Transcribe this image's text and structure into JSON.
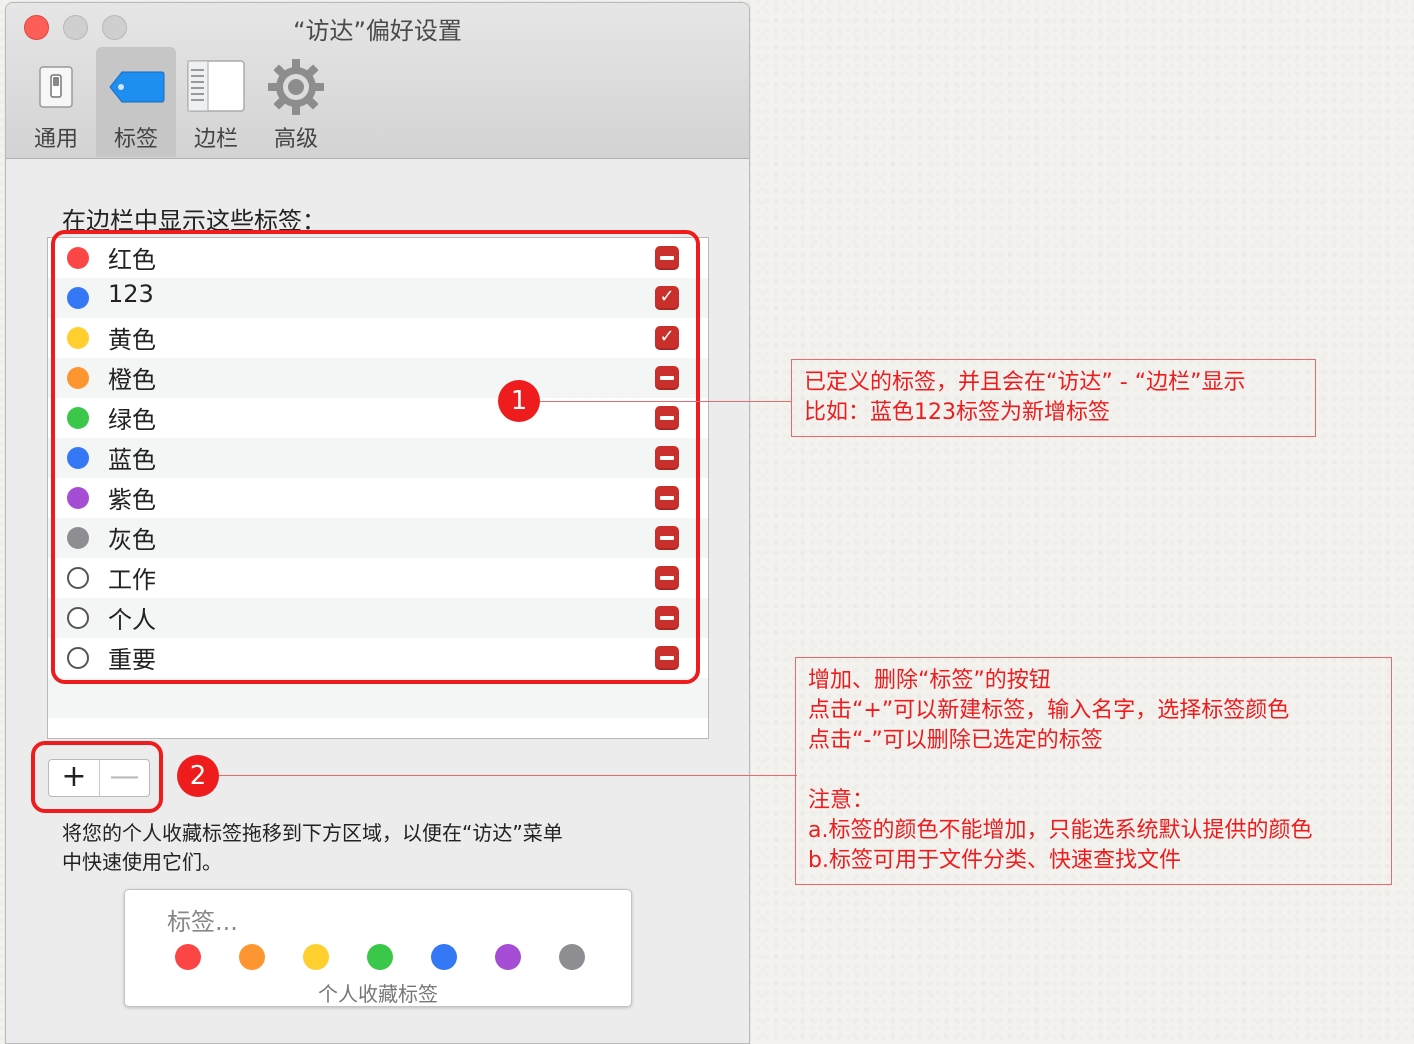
{
  "window": {
    "title": "“访达”偏好设置"
  },
  "toolbar": {
    "tabs": [
      {
        "label": "通用",
        "icon": "general-switch-icon"
      },
      {
        "label": "标签",
        "icon": "tag-icon"
      },
      {
        "label": "边栏",
        "icon": "sidebar-icon"
      },
      {
        "label": "高级",
        "icon": "gear-icon"
      }
    ],
    "selected": "标签"
  },
  "tags_section": {
    "heading": "在边栏中显示这些标签：",
    "rows": [
      {
        "name": "红色",
        "color": "#fc4646",
        "state": "minus"
      },
      {
        "name": "123",
        "color": "#3478f6",
        "state": "checked"
      },
      {
        "name": "黄色",
        "color": "#fecf2f",
        "state": "checked"
      },
      {
        "name": "橙色",
        "color": "#fd9630",
        "state": "minus"
      },
      {
        "name": "绿色",
        "color": "#3bc74a",
        "state": "minus"
      },
      {
        "name": "蓝色",
        "color": "#3478f6",
        "state": "minus"
      },
      {
        "name": "紫色",
        "color": "#a64dd6",
        "state": "minus"
      },
      {
        "name": "灰色",
        "color": "#8e8e92",
        "state": "minus"
      },
      {
        "name": "工作",
        "color": "",
        "state": "minus"
      },
      {
        "name": "个人",
        "color": "",
        "state": "minus"
      },
      {
        "name": "重要",
        "color": "",
        "state": "minus"
      }
    ],
    "check_glyph": "✓",
    "add_label": "+",
    "remove_label": "—"
  },
  "favorites": {
    "description_line1": "将您的个人收藏标签拖移到下方区域，以便在“访达”菜单",
    "description_line2": "中快速使用它们。",
    "box_title": "标签...",
    "caption": "个人收藏标签",
    "colors": [
      "#fc4646",
      "#fd9630",
      "#fecf2f",
      "#3bc74a",
      "#3478f6",
      "#a64dd6",
      "#8e8e92"
    ]
  },
  "annotations": {
    "badge1": "1",
    "badge2": "2",
    "note1": {
      "line1": "已定义的标签，并且会在“访达” - “边栏”显示",
      "line2": "比如：蓝色123标签为新增标签"
    },
    "note2": {
      "line1": "增加、删除“标签”的按钮",
      "line2": "点击“+”可以新建标签，输入名字，选择标签颜色",
      "line3": "点击“-”可以删除已选定的标签",
      "line4": "注意：",
      "line5": "a.标签的颜色不能增加，只能选系统默认提供的颜色",
      "line6": "b.标签可用于文件分类、快速查找文件"
    },
    "accent_color": "#ee1c1c"
  }
}
